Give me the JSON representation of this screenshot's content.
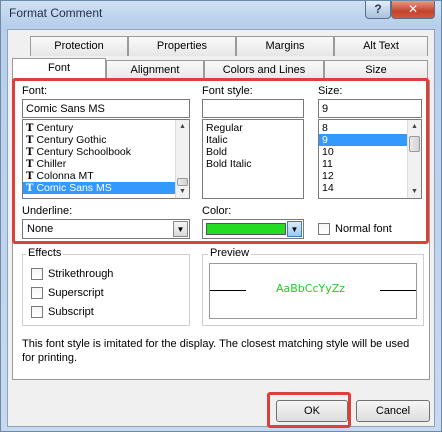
{
  "window": {
    "title": "Format Comment",
    "help_label": "?",
    "close_label": "✕"
  },
  "tabs_top": [
    {
      "label": "Protection"
    },
    {
      "label": "Properties"
    },
    {
      "label": "Margins"
    },
    {
      "label": "Alt Text"
    }
  ],
  "tabs_bottom": [
    {
      "label": "Font",
      "active": true
    },
    {
      "label": "Alignment"
    },
    {
      "label": "Colors and Lines"
    },
    {
      "label": "Size"
    }
  ],
  "font": {
    "label": "Font:",
    "value": "Comic Sans MS",
    "list": [
      "Century",
      "Century Gothic",
      "Century Schoolbook",
      "Chiller",
      "Colonna MT",
      "Comic Sans MS"
    ],
    "selected": "Comic Sans MS",
    "icon_glyph": "T"
  },
  "font_style": {
    "label": "Font style:",
    "value": "",
    "list": [
      "Regular",
      "Italic",
      "Bold",
      "Bold Italic"
    ]
  },
  "size": {
    "label": "Size:",
    "value": "9",
    "list": [
      "8",
      "9",
      "10",
      "11",
      "12",
      "14"
    ],
    "selected": "9"
  },
  "underline": {
    "label": "Underline:",
    "value": "None"
  },
  "color": {
    "label": "Color:",
    "swatch": "#22dd22"
  },
  "normal_font": {
    "label": "Normal font",
    "checked": false
  },
  "effects": {
    "label": "Effects",
    "items": [
      {
        "label": "Strikethrough",
        "checked": false
      },
      {
        "label": "Superscript",
        "checked": false
      },
      {
        "label": "Subscript",
        "checked": false
      }
    ]
  },
  "preview": {
    "label": "Preview",
    "sample": "AaBbCcYyZz",
    "sample_color": "#22cc22"
  },
  "info_text": "This font style is imitated for the display.  The closest matching style will be used for printing.",
  "buttons": {
    "ok": "OK",
    "cancel": "Cancel"
  },
  "colors": {
    "highlight": "#d9413a",
    "selection": "#3399ff"
  }
}
